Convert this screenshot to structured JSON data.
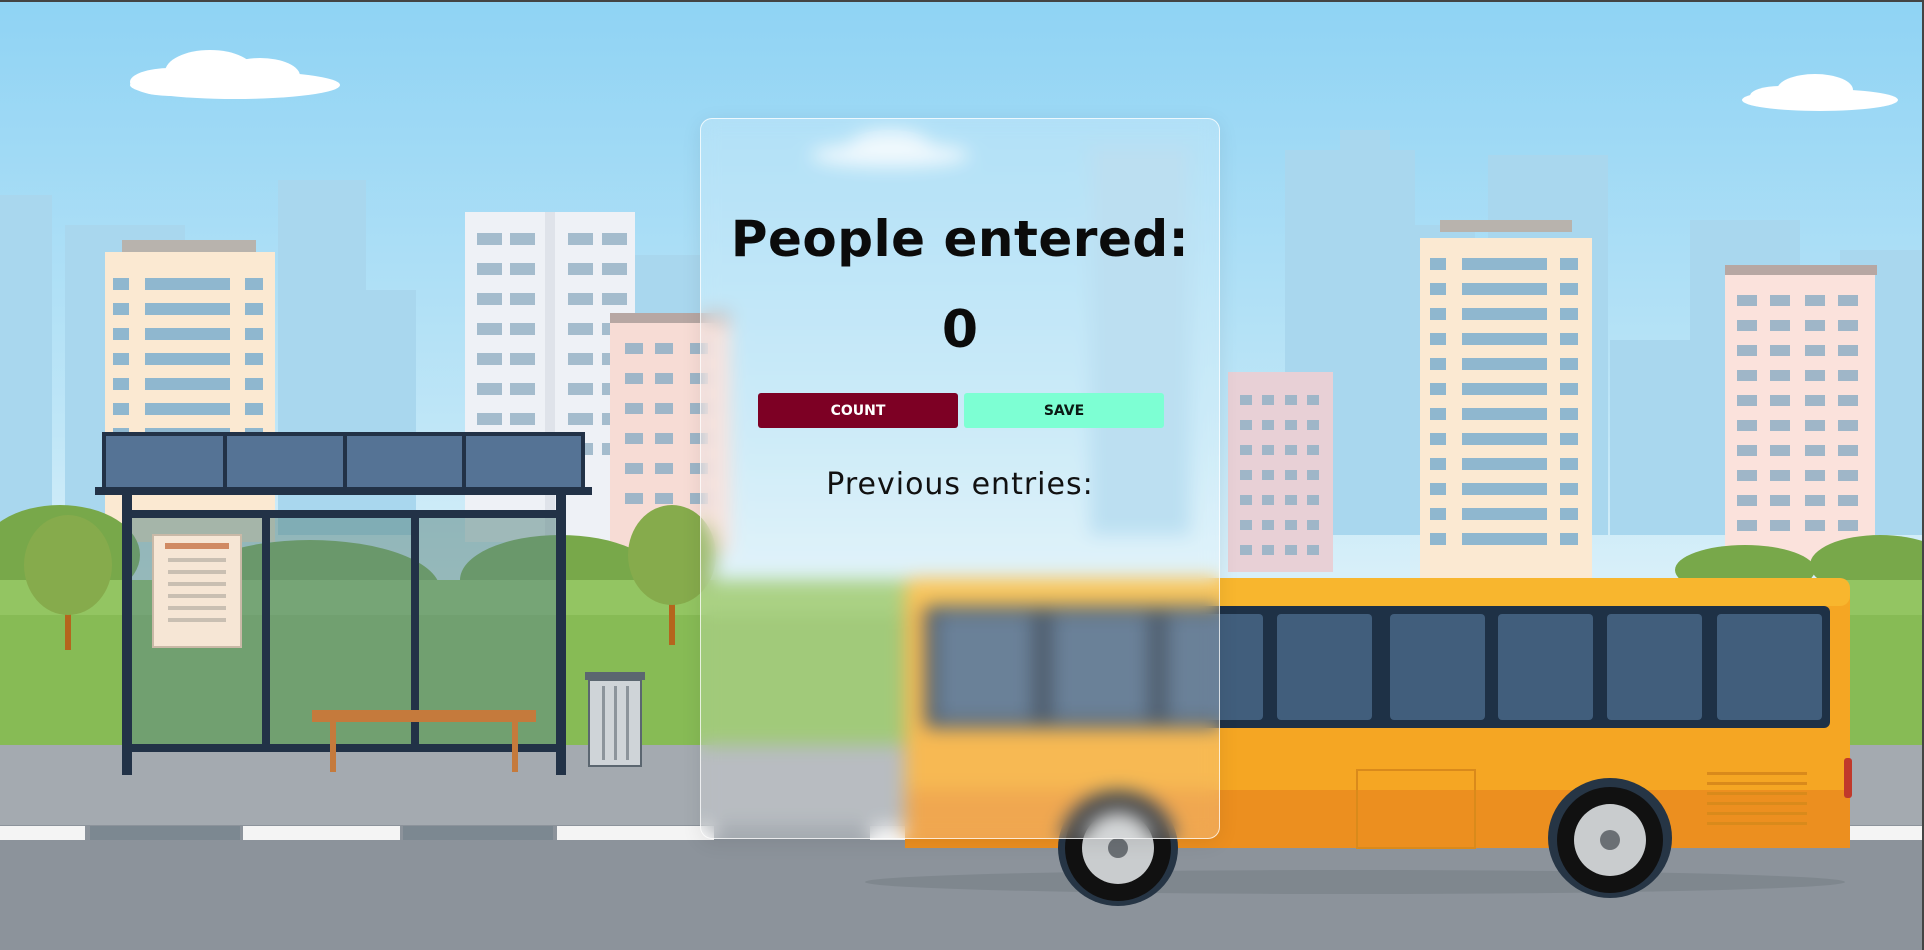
{
  "counter": {
    "title": "People entered:",
    "value": "0",
    "count_button_label": "COUNT",
    "save_button_label": "SAVE",
    "previous_entries_label": "Previous entries:",
    "previous_entries_value": ""
  },
  "colors": {
    "count_button": "#7d0024",
    "save_button": "#7dffd3",
    "sky": "#8fd3f4",
    "bus": "#f5a623"
  },
  "background": {
    "scene": "city-bus-stop-illustration"
  }
}
